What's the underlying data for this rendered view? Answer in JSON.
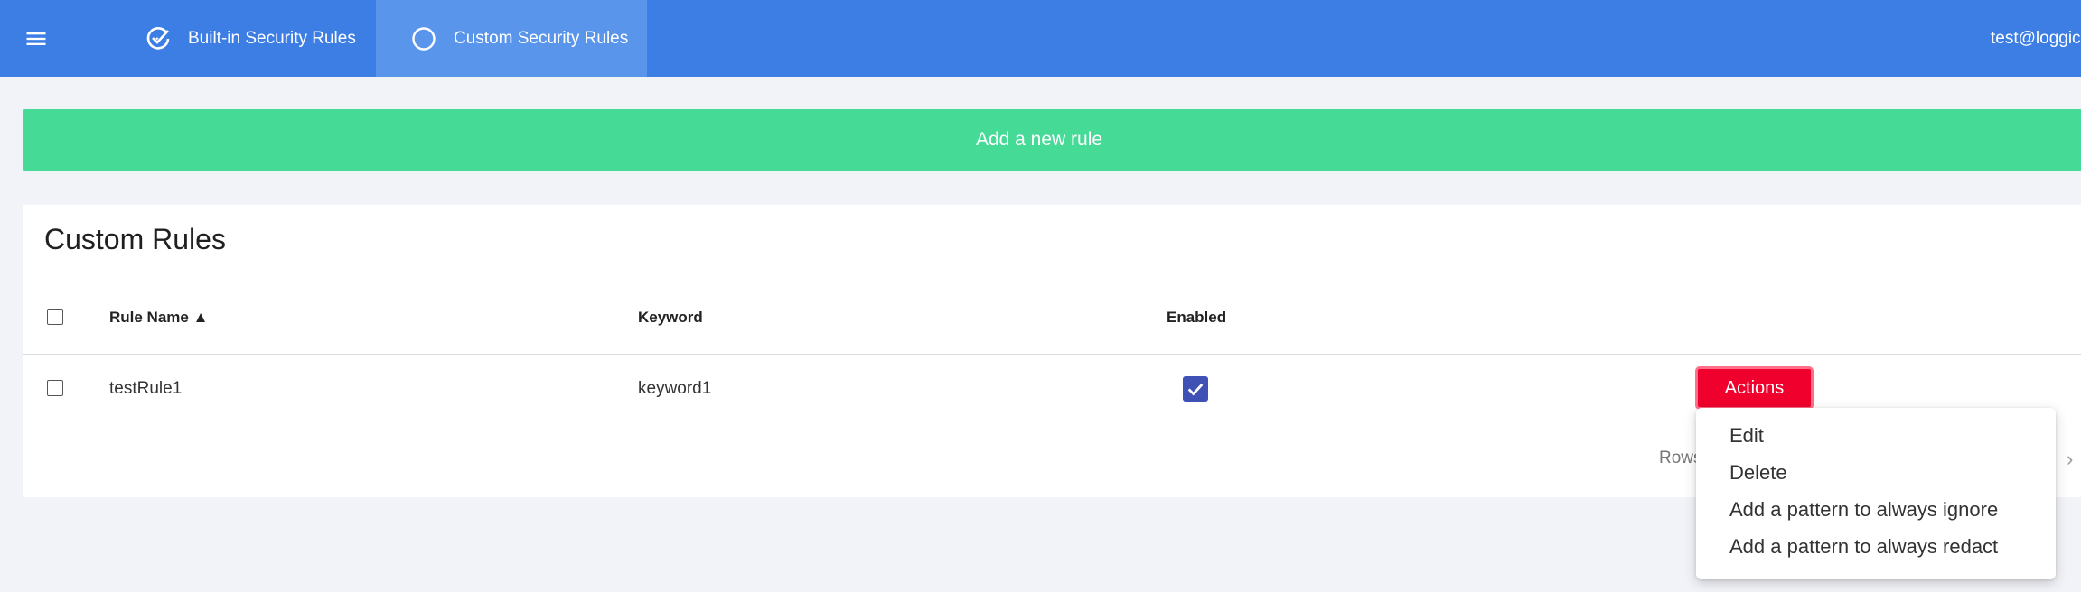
{
  "header": {
    "menu_icon": "hamburger-menu-icon",
    "tabs": [
      {
        "label": "Built-in Security Rules",
        "icon": "check-circle-icon",
        "active": false
      },
      {
        "label": "Custom Security Rules",
        "icon": "circle-outline-icon",
        "active": true
      }
    ],
    "user_email": "test@loggic"
  },
  "add_rule_button": {
    "label": "Add a new rule",
    "color": "#46da97"
  },
  "custom_rules": {
    "title": "Custom Rules",
    "columns": [
      "Rule Name ▲",
      "Keyword",
      "Enabled"
    ],
    "rows": [
      {
        "rule_name": "testRule1",
        "keyword": "keyword1",
        "enabled": true,
        "actions_label": "Actions"
      }
    ],
    "footer": {
      "rows_label": "Rows",
      "pager_icon": "chevron-right-icon"
    }
  },
  "actions_menu": {
    "items": [
      "Edit",
      "Delete",
      "Add a pattern to always ignore",
      "Add a pattern to always redact"
    ]
  },
  "colors": {
    "topbar": "#3d7ee5",
    "active_tab": "#5a95ec",
    "actions_button": "#f0002c",
    "checkbox_checked": "#3f51b5"
  }
}
